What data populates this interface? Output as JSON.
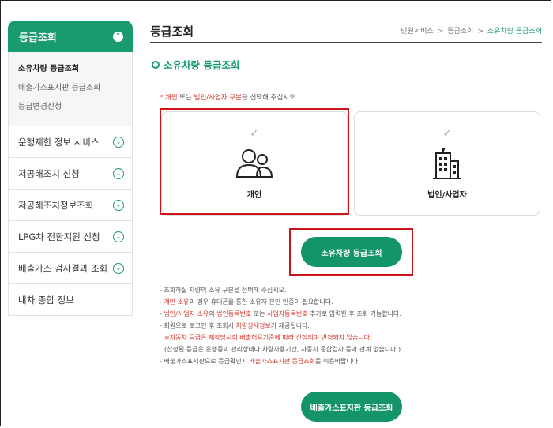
{
  "sidebar": {
    "header": "등급조회",
    "sub_items": [
      "소유차량 등급조회",
      "배출가스표지판 등급조회",
      "등급변경신청"
    ],
    "menu_items": [
      "운행제한 정보 서비스",
      "저공해조치 신청",
      "저공해조치정보조회",
      "LPG차 전환지원 신청",
      "배출가스 검사결과 조회",
      "내차 종합 정보"
    ]
  },
  "page": {
    "title": "등급조회",
    "breadcrumb": [
      "민원서비스",
      "등급조회",
      "소유차량 등급조회"
    ],
    "section_title": "소유차량 등급조회"
  },
  "instruction": {
    "star": "* ",
    "opt1": "개인",
    "mid": " 또는 ",
    "opt2": "법인/사업자 구분",
    "tail": "을 선택해 주십시오."
  },
  "cards": {
    "personal": {
      "check": "✓",
      "label": "개인",
      "icon": "people-icon"
    },
    "corp": {
      "check": "✓",
      "label": "법인/사업자",
      "icon": "building-icon"
    }
  },
  "buttons": {
    "grade_lookup": "소유차량 등급조회",
    "label_lookup": "배출가스표지판 등급조회"
  },
  "notes": {
    "n1": "- 조회하실 차량의 소유 구분을 선택해 주십시오.",
    "n2": {
      "a": "- ",
      "b": "개인 소유",
      "c": "의 경우 휴대폰을 통한 소유자 본인 인증이 필요합니다."
    },
    "n3": {
      "a": "- ",
      "b": "법인/사업자 소유",
      "c": "의 ",
      "d": "법인등록번호",
      "e": " 또는 ",
      "f": "사업자등록번호",
      "g": " 추가로 입력한 후 조회 가능합니다."
    },
    "n4": {
      "a": "- 회원으로 로그인 후 조회시 ",
      "b": "차량상세정보",
      "c": "가 제공됩니다."
    },
    "n5": "※자동차 등급은 제작당시의 배출허용기준에 따라 산정되며 변경되지 않습니다.",
    "n6": "(산정된 등급은 운행중의 관리상태나 차량사용기간, 사동차 종합검사 등과 관계 없습니다.)",
    "n7": {
      "a": "- 배출가스표지판으로 등급확인시 ",
      "b": "배출가스표지판 등급조회",
      "c": "를 이용바랍니다."
    }
  },
  "colors": {
    "brand": "#1a9b6e",
    "highlight": "#d0121b",
    "accent_text": "#d9342b"
  }
}
